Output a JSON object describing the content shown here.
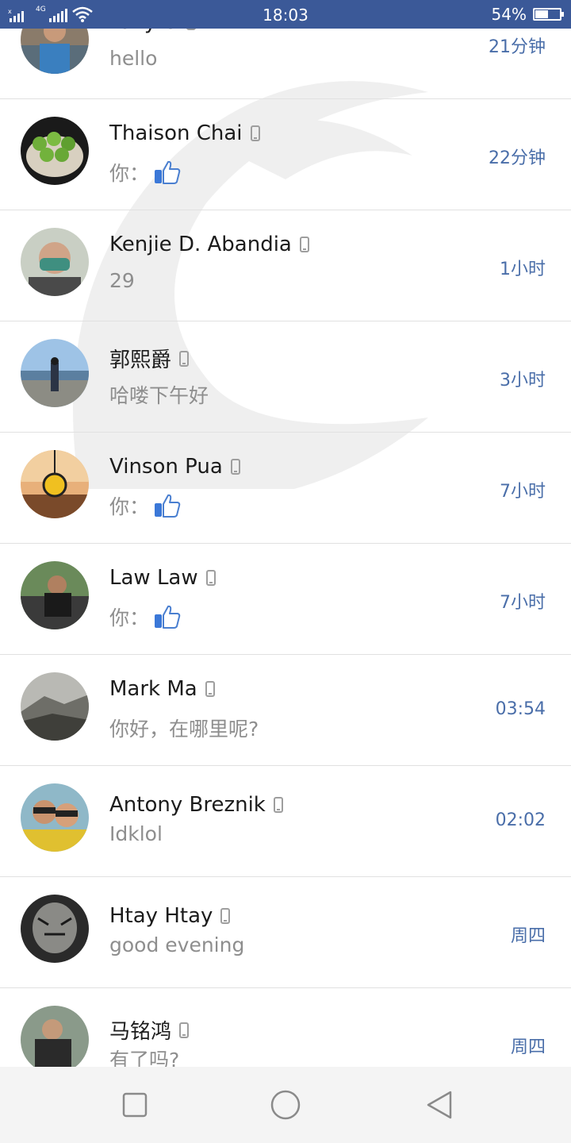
{
  "status_bar": {
    "network": "4G",
    "time": "18:03",
    "battery_percent": "54%",
    "battery_level": 0.54,
    "icons": [
      "signal-icon",
      "wifi-icon",
      "battery-icon"
    ]
  },
  "conversations": [
    {
      "name": "Tony U",
      "message": "hello",
      "time": "21分钟",
      "like": false
    },
    {
      "name": "Thaison Chai",
      "message": "你：",
      "time": "22分钟",
      "like": true
    },
    {
      "name": "Kenjie D. Abandia",
      "message": "29",
      "time": "1小时",
      "like": false
    },
    {
      "name": "郭熙爵",
      "message": "哈喽下午好",
      "time": "3小时",
      "like": false
    },
    {
      "name": "Vinson Pua",
      "message": "你：",
      "time": "7小时",
      "like": true
    },
    {
      "name": "Law Law",
      "message": "你：",
      "time": "7小时",
      "like": true
    },
    {
      "name": "Mark Ma",
      "message": "你好，在哪里呢?",
      "time": "03:54",
      "like": false
    },
    {
      "name": "Antony Breznik",
      "message": "Idklol",
      "time": "02:02",
      "like": false
    },
    {
      "name": "Htay Htay",
      "message": "good evening",
      "time": "周四",
      "like": false
    },
    {
      "name": "马铭鸿",
      "message": "有了吗?",
      "time": "周四",
      "like": false
    }
  ],
  "colors": {
    "status_bar": "#3b5998",
    "time_text": "#4a6ea9",
    "name_text": "#1c1c1c",
    "message_text": "#8e8e8e"
  },
  "nav": [
    "recents-icon",
    "home-icon",
    "back-icon"
  ]
}
